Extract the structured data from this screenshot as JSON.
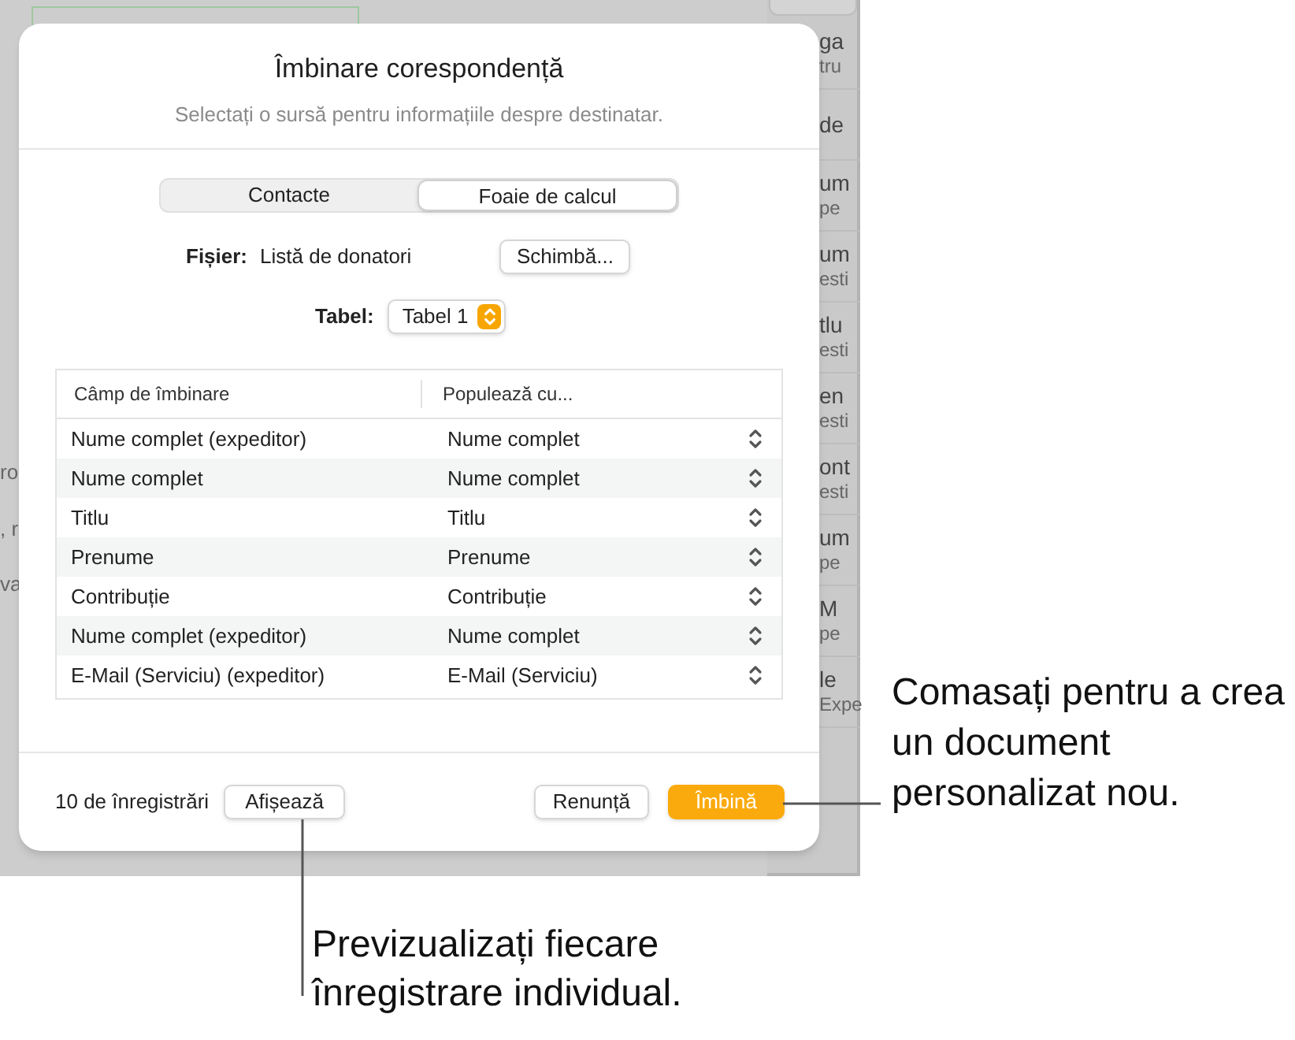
{
  "background": {
    "left_fragments": [
      "ro",
      ", r",
      "va"
    ],
    "side_rows": [
      {
        "title": "ga",
        "sub": "tru"
      },
      {
        "title": "de"
      },
      {
        "title": "um",
        "sub": "pe"
      },
      {
        "title": "um",
        "sub": "esti"
      },
      {
        "title": "tlu",
        "sub": "esti"
      },
      {
        "title": "en",
        "sub": "esti"
      },
      {
        "title": "ont",
        "sub": "esti"
      },
      {
        "title": "um",
        "sub": "pe"
      },
      {
        "title": "M",
        "sub": "pe"
      },
      {
        "title": "le",
        "sub": "Expe"
      }
    ]
  },
  "dialog": {
    "title": "Îmbinare corespondență",
    "subtitle": "Selectați o sursă pentru informațiile despre destinatar.",
    "tabs": [
      {
        "label": "Contacte",
        "selected": false
      },
      {
        "label": "Foaie de calcul",
        "selected": true
      }
    ],
    "file": {
      "label": "Fișier:",
      "value": "Listă de donatori",
      "button": "Schimbă..."
    },
    "table_select": {
      "label": "Tabel:",
      "value": "Tabel 1"
    },
    "table": {
      "columns": [
        "Câmp de îmbinare",
        "Populează cu..."
      ],
      "rows": [
        [
          "Nume complet (expeditor)",
          "Nume complet"
        ],
        [
          "Nume complet",
          "Nume complet"
        ],
        [
          "Titlu",
          "Titlu"
        ],
        [
          "Prenume",
          "Prenume"
        ],
        [
          "Contribuție",
          "Contribuție"
        ],
        [
          "Nume complet (expeditor)",
          "Nume complet"
        ],
        [
          "E-Mail (Serviciu) (expeditor)",
          "E-Mail (Serviciu)"
        ]
      ]
    },
    "record_count": "10 de înregistrări",
    "show_button": "Afișează",
    "cancel_button": "Renunță",
    "merge_button": "Îmbină"
  },
  "callouts": [
    "Comasați pentru a crea un document personalizat nou.",
    "Previzualizați fiecare înregistrare individual."
  ]
}
